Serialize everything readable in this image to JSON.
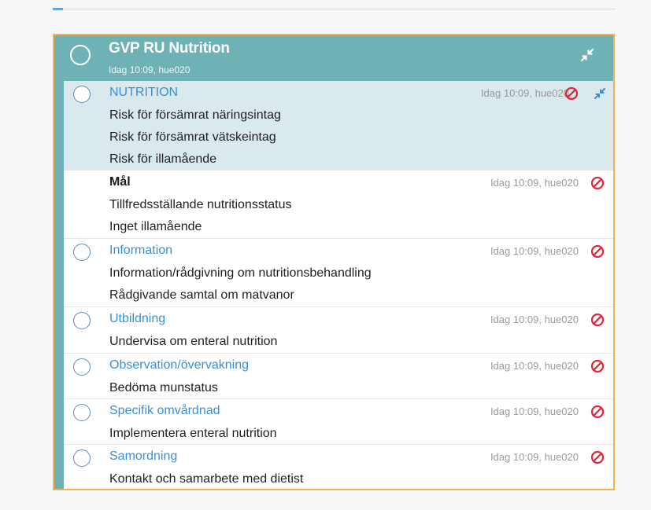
{
  "card": {
    "title": "GVP RU Nutrition",
    "meta": "Idag 10:09, hue020"
  },
  "rows": [
    {
      "title": "NUTRITION",
      "meta": "Idag 10:09, hue020",
      "lines": [
        "Risk för försämrat näringsintag",
        "Risk för försämrat vätskeintag",
        "Risk för illamående"
      ]
    },
    {
      "title": "Mål",
      "meta": "Idag 10:09, hue020",
      "lines": [
        "Tillfredsställande nutritionsstatus",
        "Inget illamående"
      ]
    },
    {
      "title": "Information",
      "meta": "Idag 10:09, hue020",
      "lines": [
        "Information/rådgivning om nutritionsbehandling",
        "Rådgivande samtal om matvanor"
      ]
    },
    {
      "title": "Utbildning",
      "meta": "Idag 10:09, hue020",
      "lines": [
        "Undervisa om enteral nutrition"
      ]
    },
    {
      "title": "Observation/övervakning",
      "meta": "Idag 10:09, hue020",
      "lines": [
        "Bedöma munstatus"
      ]
    },
    {
      "title": "Specifik omvårdnad",
      "meta": "Idag 10:09, hue020",
      "lines": [
        "Implementera enteral nutrition"
      ]
    },
    {
      "title": "Samordning",
      "meta": "Idag 10:09, hue020",
      "lines": [
        "Kontakt och samarbete med dietist"
      ]
    }
  ],
  "icons": {
    "collapse": "collapse-arrows-icon",
    "cancel": "cancel-circle-icon",
    "check": "check-circle-icon"
  },
  "colors": {
    "header": "#6fb2b6",
    "highlight": "#dae9ee",
    "link": "#3a8fd1",
    "border": "#f2b155",
    "cancel": "#e0263c",
    "collapse": "#3a8fd1"
  }
}
